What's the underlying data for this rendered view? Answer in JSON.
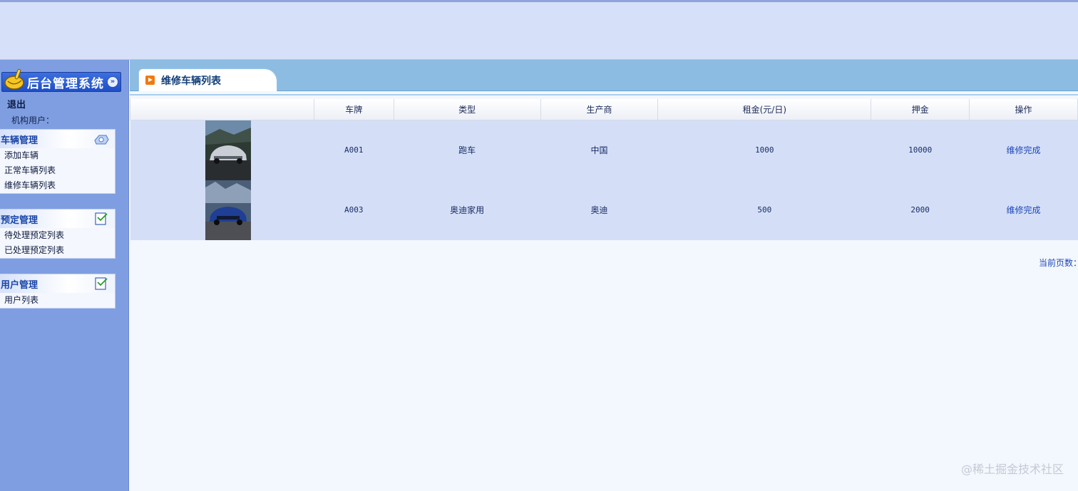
{
  "sidebar": {
    "system_title": "后台管理系统",
    "logout": "退出",
    "org_user_label": "机构用户：",
    "groups": [
      {
        "title": "车辆管理",
        "items": [
          "添加车辆",
          "正常车辆列表",
          "维修车辆列表"
        ]
      },
      {
        "title": "预定管理",
        "items": [
          "待处理预定列表",
          "已处理预定列表"
        ]
      },
      {
        "title": "用户管理",
        "items": [
          "用户列表"
        ]
      }
    ]
  },
  "main": {
    "tab_title": "维修车辆列表",
    "columns": [
      "",
      "车牌",
      "类型",
      "生产商",
      "租金(元/日)",
      "押金",
      "操作"
    ],
    "rows": [
      {
        "plate": "A001",
        "type": "跑车",
        "maker": "中国",
        "rent": "1000",
        "deposit": "10000",
        "action": "维修完成"
      },
      {
        "plate": "A003",
        "type": "奥迪家用",
        "maker": "奥迪",
        "rent": "500",
        "deposit": "2000",
        "action": "维修完成"
      }
    ],
    "pager_text": "当前页数："
  },
  "watermark": "@稀土掘金技术社区",
  "colors": {
    "topbar": "#d6e0f8",
    "sidebar": "#7f9ee1",
    "tabstrip": "#8dbce2",
    "row_bg": "#d4dff7",
    "link": "#1f47b8"
  }
}
